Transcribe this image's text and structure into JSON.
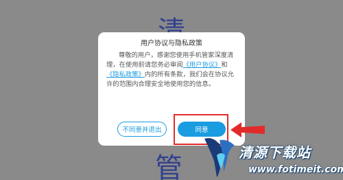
{
  "background": {
    "top_char": "清",
    "bottom_char": "管"
  },
  "dialog": {
    "title": "用户协议与隐私政策",
    "body_part1": "尊敬的用户，感谢您使用手机管家深度清理，在使用前请您务必审阅",
    "user_agreement_link": "《用户协议》",
    "conjunction": "和",
    "privacy_policy_link": "《隐私政策》",
    "body_part2": "内的所有条款，我们会在协议允许的范围内合理安全地使用您的信息。",
    "disagree_label": "不同意并退出",
    "agree_label": "同意"
  },
  "watermark": {
    "name": "清源下载站",
    "url": "www.fotimeit.com"
  },
  "colors": {
    "overlay": "#8a8a8a",
    "accent": "#1a9ce0",
    "highlight": "#e32a2a",
    "background_char": "#33408f"
  }
}
